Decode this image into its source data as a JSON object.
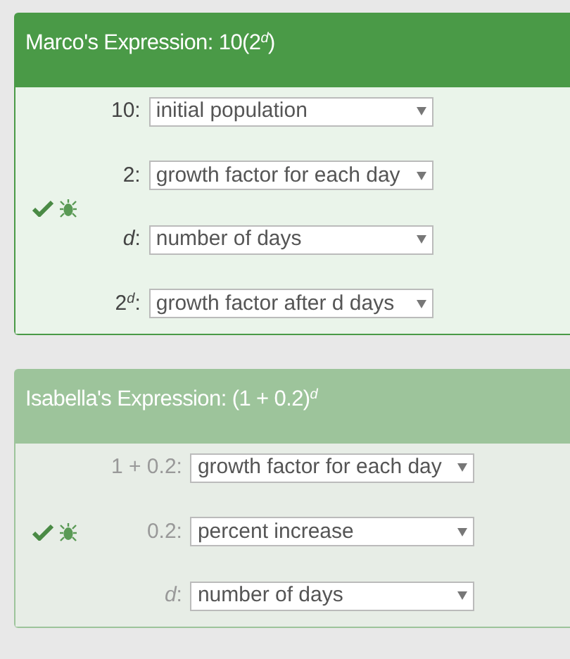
{
  "panels": [
    {
      "title": "Marco's Expression: 10(2$^{d}$)",
      "active": true,
      "correct": true,
      "rows": [
        {
          "label": "10:",
          "choice": "initial population"
        },
        {
          "label": "2:",
          "choice": "growth factor for each day"
        },
        {
          "label": "*d*:",
          "choice": "number of days"
        },
        {
          "label": "2$^{d}$:",
          "choice": "growth factor after d days"
        }
      ]
    },
    {
      "title": "Isabella's Expression: (1 + 0.2)$^{d}$",
      "active": false,
      "correct": true,
      "rows": [
        {
          "label": "1 + 0.2:",
          "choice": "growth factor for each day"
        },
        {
          "label": "0.2:",
          "choice": "percent increase"
        },
        {
          "label": "*d*:",
          "choice": "number of days"
        }
      ]
    }
  ]
}
